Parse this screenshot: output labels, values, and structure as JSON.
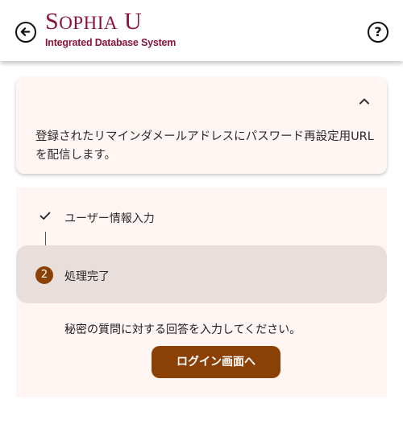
{
  "header": {
    "back_icon": "arrow-left-circle-icon",
    "logo": {
      "main": "SOPHIA U",
      "sub": "Integrated Database System"
    },
    "help_icon": "question-circle-icon",
    "help_symbol": "?"
  },
  "info_card": {
    "collapse_icon": "chevron-up-icon",
    "message": "登録されたリマインダメールアドレスにパスワード再設定用URLを配信します。"
  },
  "stepper": {
    "steps": [
      {
        "label": "ユーザー情報入力",
        "status": "completed",
        "icon": "check-icon"
      },
      {
        "label": "処理完了",
        "status": "active",
        "number": "2"
      }
    ],
    "message": "秘密の質問に対する回答を入力してください。",
    "login_button": "ログイン画面へ"
  },
  "colors": {
    "brand": "#8a1538",
    "accent": "#8b4106",
    "card_background": "#fff6f3",
    "active_step_background": "#e8dedc"
  }
}
